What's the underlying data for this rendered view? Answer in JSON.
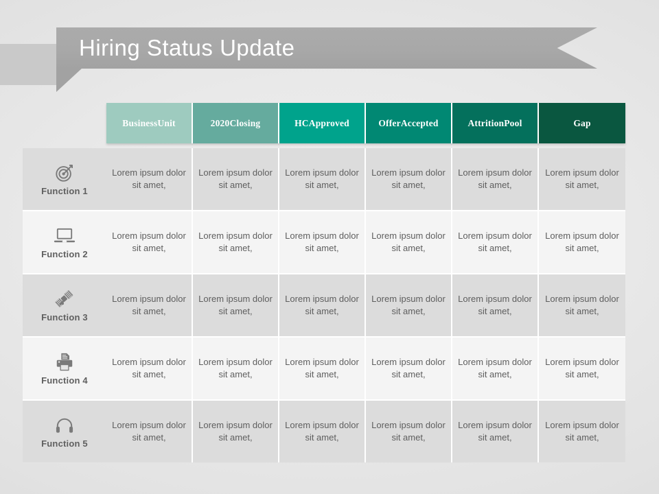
{
  "slide": {
    "title": "Hiring Status Update",
    "background_color": "#e6e6e6"
  },
  "ribbon": {
    "bar_color": "#a8a8a8",
    "fold_color": "#a2a2a2",
    "tab_color": "#c9c9c9",
    "title_color": "#ffffff"
  },
  "table": {
    "columns": [
      {
        "label": "Business\nUnit",
        "line1": "Business",
        "line2": "Unit",
        "color": "#9ecbbf"
      },
      {
        "label": "2020 Closing",
        "line1": "2020",
        "line2": "Closing",
        "color": "#65ab9e"
      },
      {
        "label": "HC Approved",
        "line1": "HC",
        "line2": "Approved",
        "color": "#00a38c"
      },
      {
        "label": "Offer Accepted",
        "line1": "Offer",
        "line2": "Accepted",
        "color": "#018873"
      },
      {
        "label": "Attrition Pool",
        "line1": "Attrition",
        "line2": "Pool",
        "color": "#04705c"
      },
      {
        "label": "Gap",
        "line1": "Gap",
        "line2": "",
        "color": "#0a5740"
      }
    ],
    "rows": [
      {
        "label": "Function 1",
        "icon": "target-icon",
        "band": "dark",
        "cells": [
          "Lorem ipsum dolor sit amet,",
          "Lorem ipsum dolor sit amet,",
          "Lorem ipsum dolor sit amet,",
          "Lorem ipsum dolor sit amet,",
          "Lorem ipsum dolor sit amet,",
          "Lorem ipsum dolor sit amet,"
        ]
      },
      {
        "label": "Function 2",
        "icon": "laptop-icon",
        "band": "light",
        "cells": [
          "Lorem ipsum dolor sit amet,",
          "Lorem ipsum dolor sit amet,",
          "Lorem ipsum dolor sit amet,",
          "Lorem ipsum dolor sit amet,",
          "Lorem ipsum dolor sit amet,",
          "Lorem ipsum dolor sit amet,"
        ]
      },
      {
        "label": "Function 3",
        "icon": "satellite-icon",
        "band": "dark",
        "cells": [
          "Lorem ipsum dolor sit amet,",
          "Lorem ipsum dolor sit amet,",
          "Lorem ipsum dolor sit amet,",
          "Lorem ipsum dolor sit amet,",
          "Lorem ipsum dolor sit amet,",
          "Lorem ipsum dolor sit amet,"
        ]
      },
      {
        "label": "Function 4",
        "icon": "printer-icon",
        "band": "light",
        "cells": [
          "Lorem ipsum dolor sit amet,",
          "Lorem ipsum dolor sit amet,",
          "Lorem ipsum dolor sit amet,",
          "Lorem ipsum dolor sit amet,",
          "Lorem ipsum dolor sit amet,",
          "Lorem ipsum dolor sit amet,"
        ]
      },
      {
        "label": "Function 5",
        "icon": "headphones-icon",
        "band": "dark",
        "cells": [
          "Lorem ipsum dolor sit amet,",
          "Lorem ipsum dolor sit amet,",
          "Lorem ipsum dolor sit amet,",
          "Lorem ipsum dolor sit amet,",
          "Lorem ipsum dolor sit amet,",
          "Lorem ipsum dolor sit amet,"
        ]
      }
    ]
  }
}
